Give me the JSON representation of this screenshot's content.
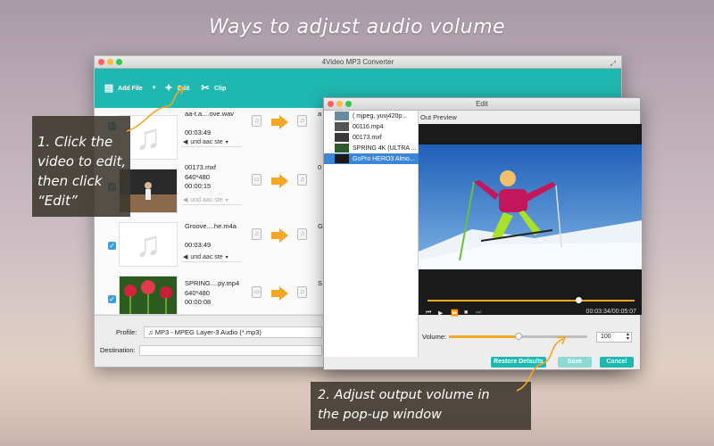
{
  "headline": "Ways to adjust audio volume",
  "main_window": {
    "title": "4Video MP3 Converter",
    "toolbar": {
      "add_file": "Add File",
      "edit": "Edit",
      "clip": "Clip"
    },
    "files": [
      {
        "name": "aa-t.a....ove.wav",
        "line2": "00:03:49",
        "line3": "",
        "audio": "und aac ste",
        "out": "a"
      },
      {
        "name": "00173.mxf",
        "line2": "640*480",
        "line3": "00:00:15",
        "audio": "und aac ste",
        "out": "0"
      },
      {
        "name": "Groove....he.m4a",
        "line2": "00:03:49",
        "line3": "",
        "audio": "und aac ste",
        "out": "G"
      },
      {
        "name": "SPRING....py.mp4",
        "line2": "640*480",
        "line3": "00:00:08",
        "audio": "und aac ste",
        "out": "S"
      }
    ],
    "profile_label": "Profile:",
    "profile_value": "MP3 - MPEG Layer-3 Audio (*.mp3)",
    "destination_label": "Destination:"
  },
  "edit_window": {
    "title": "Edit",
    "list": [
      {
        "name": "( mjpeg, yuvj420p...",
        "selected": false
      },
      {
        "name": "00116.mp4",
        "selected": false
      },
      {
        "name": "00173.mxf",
        "selected": false
      },
      {
        "name": "SPRING 4K (ULTRA ...",
        "selected": false
      },
      {
        "name": "GoPro HERO3 Almo...",
        "selected": true
      }
    ],
    "preview_label": "Out Preview",
    "time": "00:03:34/00:05:07",
    "seek_fraction": 0.73,
    "volume_label": "Volume:",
    "volume_value": "100",
    "volume_fraction": 0.5,
    "restore_button": "Restore Defaults",
    "save_button": "Save",
    "cancel_button": "Cancel"
  },
  "callout1": {
    "line1": "1. Click the",
    "line2": "video to edit,",
    "line3": "then click",
    "line4": "“Edit”"
  },
  "callout2": {
    "line1": "2. Adjust output volume in",
    "line2": "the pop-up window"
  },
  "colors": {
    "teal": "#1fb8b0",
    "orange": "#f5a623",
    "select_blue": "#3b86d6"
  }
}
